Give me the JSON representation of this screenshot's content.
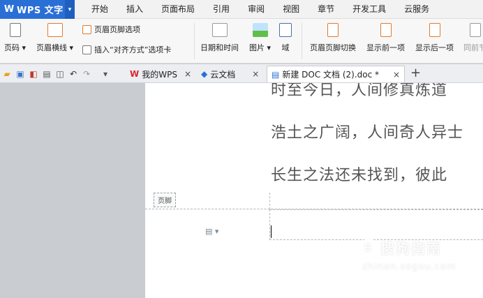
{
  "app": {
    "title": "WPS 文字"
  },
  "menu": [
    "开始",
    "插入",
    "页面布局",
    "引用",
    "审阅",
    "视图",
    "章节",
    "开发工具",
    "云服务"
  ],
  "ribbon": {
    "page_number": "页码",
    "header_line": "页眉横线",
    "header_footer_options": "页眉页脚选项",
    "insert_tab_align": "插入“对齐方式”选项卡",
    "date_time": "日期和时间",
    "picture": "图片",
    "field": "域",
    "switch_header_footer": "页眉页脚切换",
    "show_previous": "显示前一项",
    "show_next": "显示后一项",
    "same_as_previous": "同前节"
  },
  "tabs": [
    {
      "label": "我的WPS"
    },
    {
      "label": "云文档"
    },
    {
      "label": "新建 DOC 文档 (2).doc *"
    }
  ],
  "document": {
    "lines": [
      "时至今日，人间修真炼道",
      "浩土之广阔，人间奇人异士",
      "长生之法还未找到，彼此"
    ],
    "footer_label": "页脚"
  },
  "watermark": {
    "main": "搜狗指南",
    "sub": "zhinan.sogou.com"
  },
  "colors": {
    "app_blue": "#2a6fd6",
    "icon_orange": "#e07a2e",
    "wps_red": "#d9262e"
  }
}
